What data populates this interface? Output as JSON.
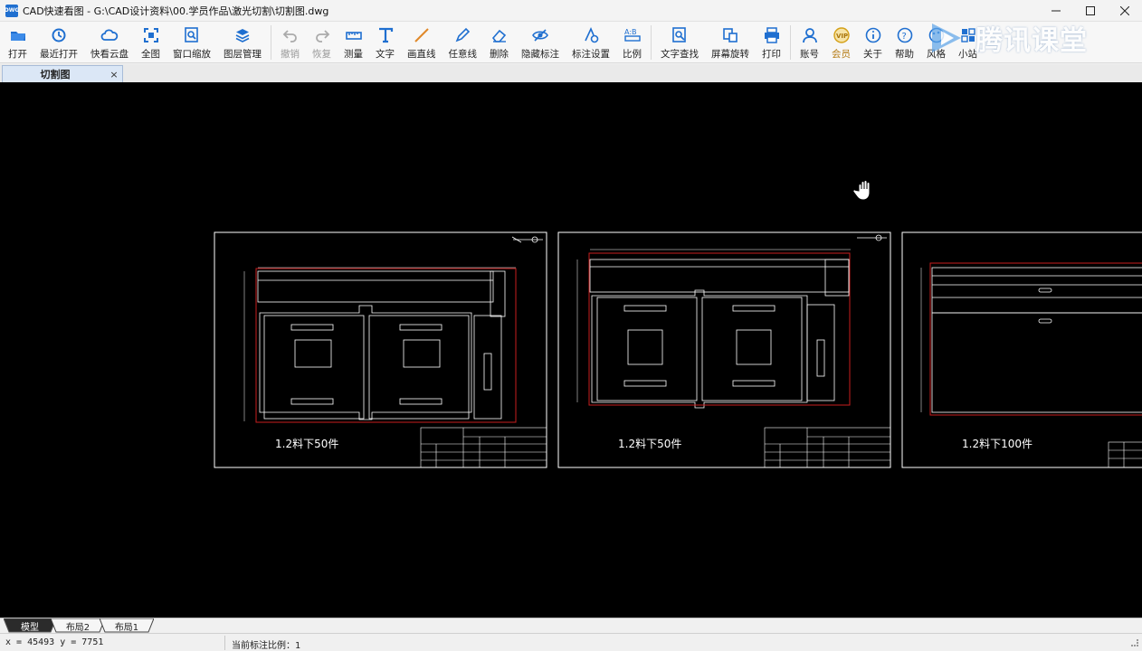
{
  "window": {
    "title": "CAD快速看图 - G:\\CAD设计资料\\00.学员作品\\激光切割\\切割图.dwg",
    "controls": [
      "minimize",
      "maximize",
      "close"
    ]
  },
  "toolbar": {
    "open": "打开",
    "recent": "最近打开",
    "cloud": "快看云盘",
    "full_view": "全图",
    "window_zoom": "窗口缩放",
    "layer_manager": "图层管理",
    "undo": "撤销",
    "redo": "恢复",
    "measure": "测量",
    "text": "文字",
    "line": "画直线",
    "freehand": "任意线",
    "delete": "删除",
    "hide_dims": "隐藏标注",
    "dim_settings": "标注设置",
    "scale": "比例",
    "text_search": "文字查找",
    "rotate_screen": "屏幕旋转",
    "print": "打印",
    "account": "账号",
    "member": "会员",
    "about": "关于",
    "help": "帮助",
    "style": "风格",
    "mini_site": "小站"
  },
  "watermark": {
    "text": "腾讯课堂"
  },
  "document_tab": {
    "label": "切割图",
    "close": "×"
  },
  "drawing": {
    "sheets": [
      {
        "note": "1.2料下50件"
      },
      {
        "note": "1.2料下50件"
      },
      {
        "note": "1.2料下100件"
      }
    ]
  },
  "layout_tabs": [
    "模型",
    "布局2",
    "布局1"
  ],
  "status": {
    "coords": "x = 45493  y = 7751",
    "scale": "当前标注比例：1"
  },
  "colors": {
    "canvas": "#000000",
    "cut_outline": "#c81e1e",
    "accent": "#1f6fd0",
    "vip": "#d4a017"
  }
}
